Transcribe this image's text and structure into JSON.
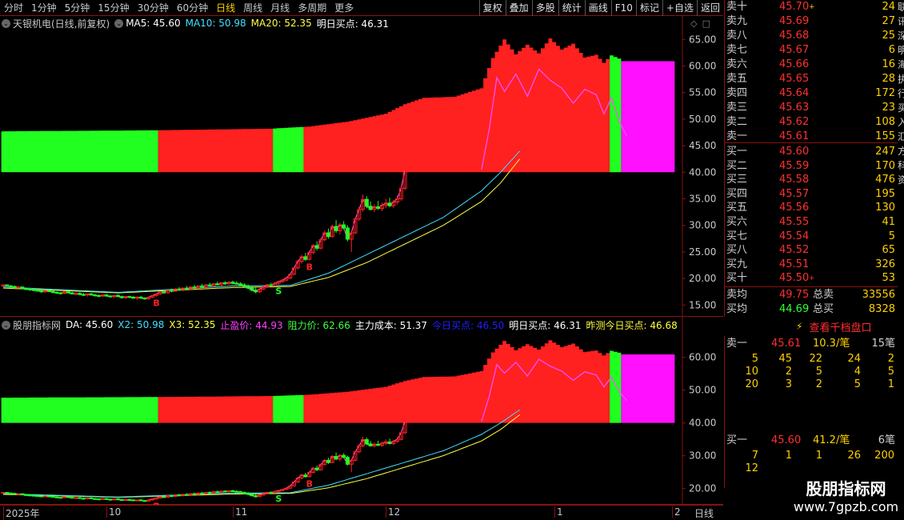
{
  "toolbar": {
    "periods": [
      "分时",
      "1分钟",
      "5分钟",
      "15分钟",
      "30分钟",
      "60分钟",
      "日线",
      "周线",
      "月线",
      "多周期",
      "更多"
    ],
    "active_period": 6,
    "tools": [
      "复权",
      "叠加",
      "多股",
      "统计",
      "画线",
      "F10",
      "标记",
      "+自选",
      "返回"
    ]
  },
  "main_chart": {
    "stock_name": "天银机电(日线,前复权)",
    "ma5_label": "MA5: 45.60",
    "ma10_label": "MA10: 50.98",
    "ma20_label": "MA20: 52.35",
    "buy_point_label": "明日买点: 46.31",
    "price_axis": [
      "65.00",
      "60.00",
      "55.00",
      "50.00",
      "45.00",
      "40.00",
      "35.00",
      "30.00",
      "25.00",
      "20.00",
      "15.00"
    ],
    "marker_labels": [
      "B",
      "S",
      "B"
    ]
  },
  "sub_chart": {
    "indicator_name": "股朋指标网",
    "da_label": "DA: 45.60",
    "x2_label": "X2: 50.98",
    "x3_label": "X3: 52.35",
    "stop_profit_label": "止盈价: 44.93",
    "resistance_label": "阻力价: 62.66",
    "main_cost_label": "主力成本: 51.37",
    "today_buy_label": "今日买点: 46.50",
    "tomorrow_buy_label": "明日买点: 46.31",
    "yesterday_pred_label": "昨测今日买点: 46.68",
    "price_axis": [
      "60.00",
      "50.00",
      "40.00",
      "30.00",
      "20.00"
    ]
  },
  "time_axis": {
    "labels": [
      "2025年",
      "10",
      "11",
      "12",
      "1",
      "2"
    ],
    "mode": "日线"
  },
  "colors": {
    "up": "#ff2020",
    "down": "#20ff20",
    "magenta": "#ff10ff",
    "ma5": "#ffffff",
    "ma10": "#40e0ff",
    "ma20": "#ffff40",
    "frame": "#8a1010"
  },
  "orderbook": {
    "sell": [
      {
        "label": "卖十",
        "price": "45.70",
        "vol": "24",
        "mark": "+"
      },
      {
        "label": "卖九",
        "price": "45.69",
        "vol": "27",
        "mark": ""
      },
      {
        "label": "卖八",
        "price": "45.68",
        "vol": "25",
        "mark": ""
      },
      {
        "label": "卖七",
        "price": "45.67",
        "vol": "6",
        "mark": ""
      },
      {
        "label": "卖六",
        "price": "45.66",
        "vol": "16",
        "mark": ""
      },
      {
        "label": "卖五",
        "price": "45.65",
        "vol": "28",
        "mark": ""
      },
      {
        "label": "卖四",
        "price": "45.64",
        "vol": "172",
        "mark": ""
      },
      {
        "label": "卖三",
        "price": "45.63",
        "vol": "23",
        "mark": ""
      },
      {
        "label": "卖二",
        "price": "45.62",
        "vol": "108",
        "mark": ""
      },
      {
        "label": "卖一",
        "price": "45.61",
        "vol": "155",
        "mark": ""
      }
    ],
    "buy": [
      {
        "label": "买一",
        "price": "45.60",
        "vol": "247",
        "mark": ""
      },
      {
        "label": "买二",
        "price": "45.59",
        "vol": "170",
        "mark": ""
      },
      {
        "label": "买三",
        "price": "45.58",
        "vol": "476",
        "mark": ""
      },
      {
        "label": "买四",
        "price": "45.57",
        "vol": "195",
        "mark": ""
      },
      {
        "label": "买五",
        "price": "45.56",
        "vol": "130",
        "mark": ""
      },
      {
        "label": "买六",
        "price": "45.55",
        "vol": "41",
        "mark": ""
      },
      {
        "label": "买七",
        "price": "45.54",
        "vol": "5",
        "mark": ""
      },
      {
        "label": "买八",
        "price": "45.52",
        "vol": "65",
        "mark": ""
      },
      {
        "label": "买九",
        "price": "45.51",
        "vol": "326",
        "mark": ""
      },
      {
        "label": "买十",
        "price": "45.50",
        "vol": "53",
        "mark": "+"
      }
    ],
    "summary": {
      "sell_avg_label": "卖均",
      "sell_avg": "49.75",
      "total_sell_label": "总卖",
      "total_sell": "33556",
      "buy_avg_label": "买均",
      "buy_avg": "44.69",
      "total_buy_label": "总买",
      "total_buy": "8328"
    },
    "side_strip_text": "联讯深明海执行买入汇方科资"
  },
  "kilo": {
    "button_label": "查看千档盘口",
    "sell_head": {
      "label": "卖一",
      "price": "45.61",
      "avg": "10.3/笔",
      "count": "15笔"
    },
    "sell_rows": [
      [
        "5",
        "45",
        "22",
        "24",
        "2"
      ],
      [
        "10",
        "2",
        "5",
        "4",
        "5"
      ],
      [
        "20",
        "3",
        "2",
        "5",
        "1"
      ]
    ],
    "buy_head": {
      "label": "买一",
      "price": "45.60",
      "avg": "41.2/笔",
      "count": "6笔"
    },
    "buy_rows": [
      [
        "7",
        "1",
        "1",
        "26",
        "200"
      ],
      [
        "12",
        "",
        "",
        "",
        ""
      ]
    ]
  },
  "watermark": {
    "title": "股朋指标网",
    "url": "www.7gpzb.com"
  },
  "chart_data": {
    "type": "candlestick",
    "y_range": [
      14,
      67
    ],
    "candles": [
      [
        18.6,
        18.9,
        18.4,
        18.8
      ],
      [
        18.8,
        18.9,
        18.5,
        18.6
      ],
      [
        18.6,
        18.8,
        18.3,
        18.5
      ],
      [
        18.5,
        18.7,
        18.2,
        18.3
      ],
      [
        18.3,
        18.6,
        18.1,
        18.4
      ],
      [
        18.4,
        18.5,
        18.0,
        18.1
      ],
      [
        18.1,
        18.3,
        17.8,
        18.0
      ],
      [
        18.0,
        18.2,
        17.7,
        17.9
      ],
      [
        17.9,
        18.1,
        17.6,
        17.8
      ],
      [
        17.8,
        18.0,
        17.5,
        17.7
      ],
      [
        17.7,
        17.9,
        17.3,
        17.5
      ],
      [
        17.5,
        17.8,
        17.3,
        17.7
      ],
      [
        17.7,
        17.9,
        17.4,
        17.6
      ],
      [
        17.6,
        17.8,
        17.2,
        17.4
      ],
      [
        17.4,
        17.6,
        17.1,
        17.3
      ],
      [
        17.3,
        17.5,
        17.0,
        17.2
      ],
      [
        17.2,
        17.6,
        17.1,
        17.5
      ],
      [
        17.5,
        17.7,
        17.2,
        17.3
      ],
      [
        17.3,
        17.5,
        17.0,
        17.1
      ],
      [
        17.1,
        17.4,
        16.8,
        17.2
      ],
      [
        17.2,
        17.4,
        16.9,
        17.0
      ],
      [
        17.0,
        17.3,
        16.7,
        16.9
      ],
      [
        16.9,
        17.2,
        16.6,
        17.1
      ],
      [
        17.1,
        17.3,
        16.8,
        16.9
      ],
      [
        16.9,
        17.1,
        16.6,
        16.8
      ],
      [
        16.8,
        17.0,
        16.5,
        16.7
      ],
      [
        16.7,
        17.0,
        16.5,
        16.9
      ],
      [
        16.9,
        17.1,
        16.6,
        16.7
      ],
      [
        16.7,
        16.9,
        16.4,
        16.6
      ],
      [
        16.6,
        16.9,
        16.3,
        16.8
      ],
      [
        16.8,
        17.0,
        16.5,
        16.6
      ],
      [
        16.6,
        16.8,
        16.2,
        16.4
      ],
      [
        16.4,
        16.7,
        16.1,
        16.6
      ],
      [
        16.6,
        16.8,
        16.3,
        16.5
      ],
      [
        16.5,
        16.7,
        16.2,
        16.3
      ],
      [
        16.3,
        16.6,
        16.0,
        16.5
      ],
      [
        16.5,
        16.7,
        16.2,
        16.3
      ],
      [
        16.3,
        16.5,
        16.0,
        16.2
      ],
      [
        16.2,
        16.6,
        16.0,
        16.5
      ],
      [
        16.5,
        16.9,
        16.3,
        16.8
      ],
      [
        16.8,
        17.2,
        16.6,
        17.1
      ],
      [
        17.1,
        17.6,
        16.9,
        17.5
      ],
      [
        17.5,
        17.8,
        17.1,
        17.3
      ],
      [
        17.3,
        17.9,
        17.2,
        17.8
      ],
      [
        17.8,
        18.1,
        17.4,
        17.6
      ],
      [
        17.6,
        18.2,
        17.5,
        18.0
      ],
      [
        18.0,
        18.4,
        17.7,
        17.8
      ],
      [
        17.8,
        18.3,
        17.6,
        18.2
      ],
      [
        18.2,
        18.6,
        17.9,
        18.0
      ],
      [
        18.0,
        18.5,
        17.8,
        18.4
      ],
      [
        18.4,
        18.8,
        18.1,
        18.2
      ],
      [
        18.2,
        18.7,
        18.0,
        18.6
      ],
      [
        18.6,
        19.0,
        18.2,
        18.4
      ],
      [
        18.4,
        18.9,
        18.2,
        18.8
      ],
      [
        18.8,
        19.2,
        18.5,
        18.6
      ],
      [
        18.6,
        19.1,
        18.4,
        19.0
      ],
      [
        19.0,
        19.4,
        18.7,
        18.8
      ],
      [
        18.8,
        19.3,
        18.6,
        19.2
      ],
      [
        19.2,
        19.5,
        18.8,
        19.0
      ],
      [
        19.0,
        19.5,
        18.8,
        19.3
      ],
      [
        19.3,
        19.6,
        18.9,
        19.1
      ],
      [
        19.1,
        19.5,
        18.8,
        19.0
      ],
      [
        19.0,
        19.3,
        18.6,
        18.8
      ],
      [
        18.8,
        19.1,
        18.3,
        18.5
      ],
      [
        18.5,
        18.9,
        18.0,
        18.2
      ],
      [
        18.2,
        18.6,
        17.6,
        17.8
      ],
      [
        17.8,
        18.3,
        17.2,
        17.5
      ],
      [
        17.5,
        18.2,
        17.3,
        18.0
      ],
      [
        18.0,
        18.6,
        17.8,
        18.4
      ],
      [
        18.4,
        19.0,
        18.2,
        18.8
      ],
      [
        18.8,
        19.2,
        18.5,
        18.7
      ],
      [
        18.7,
        19.3,
        18.5,
        19.1
      ],
      [
        19.1,
        19.6,
        18.9,
        19.4
      ],
      [
        19.4,
        19.9,
        19.2,
        19.7
      ],
      [
        19.7,
        20.3,
        19.5,
        20.1
      ],
      [
        20.1,
        21.0,
        19.9,
        20.8
      ],
      [
        20.8,
        22.2,
        20.6,
        22.0
      ],
      [
        22.0,
        23.5,
        21.7,
        23.2
      ],
      [
        23.2,
        24.5,
        22.8,
        24.1
      ],
      [
        24.1,
        24.8,
        23.3,
        23.6
      ],
      [
        23.6,
        25.2,
        23.4,
        24.9
      ],
      [
        24.9,
        26.5,
        24.6,
        26.2
      ],
      [
        26.2,
        27.0,
        25.3,
        25.7
      ],
      [
        25.7,
        27.6,
        25.5,
        27.3
      ],
      [
        27.3,
        29.0,
        27.0,
        28.6
      ],
      [
        28.6,
        29.4,
        27.5,
        27.9
      ],
      [
        27.9,
        30.2,
        27.7,
        29.8
      ],
      [
        29.8,
        31.0,
        28.6,
        29.0
      ],
      [
        29.0,
        30.5,
        28.3,
        30.1
      ],
      [
        30.1,
        30.8,
        29.2,
        29.5
      ],
      [
        29.5,
        30.0,
        27.0,
        27.4
      ],
      [
        27.4,
        29.0,
        25.0,
        28.6
      ],
      [
        28.6,
        31.5,
        28.3,
        31.2
      ],
      [
        31.2,
        33.5,
        30.8,
        33.0
      ],
      [
        33.0,
        35.8,
        32.6,
        34.9
      ],
      [
        34.9,
        35.5,
        33.2,
        33.6
      ],
      [
        33.6,
        34.5,
        32.8,
        33.0
      ],
      [
        33.0,
        34.0,
        32.5,
        33.5
      ],
      [
        33.5,
        34.6,
        32.9,
        33.2
      ],
      [
        33.2,
        34.3,
        32.7,
        33.8
      ],
      [
        33.8,
        35.0,
        33.2,
        34.2
      ],
      [
        34.2,
        35.2,
        33.4,
        33.7
      ],
      [
        33.7,
        34.8,
        33.3,
        34.4
      ],
      [
        34.4,
        35.6,
        33.9,
        35.0
      ],
      [
        35.0,
        37.5,
        34.6,
        37.0
      ],
      [
        37.0,
        41.0,
        36.6,
        40.5
      ]
    ],
    "strip_segments": [
      {
        "from": 0,
        "to": 40,
        "color": "down"
      },
      {
        "from": 41,
        "to": 70,
        "color": "up"
      },
      {
        "from": 71,
        "to": 78,
        "color": "down"
      },
      {
        "from": 79,
        "to": 158,
        "color": "up"
      },
      {
        "from": 159,
        "to": 161,
        "color": "down"
      },
      {
        "from": 162,
        "to": 175,
        "color": "magenta"
      }
    ],
    "strip_base": 40,
    "strip_tops": [
      [
        0,
        47.7
      ],
      [
        40,
        47.9
      ],
      [
        70,
        48.2
      ],
      [
        80,
        48.6
      ],
      [
        90,
        49.5
      ],
      [
        100,
        51.0
      ],
      [
        105,
        52.8
      ],
      [
        110,
        54.0
      ],
      [
        118,
        54.2
      ],
      [
        125,
        55.8
      ],
      [
        128,
        61.5
      ],
      [
        131,
        65.0
      ],
      [
        134,
        62.2
      ],
      [
        137,
        64.0
      ],
      [
        140,
        62.4
      ],
      [
        143,
        65.2
      ],
      [
        146,
        63.1
      ],
      [
        149,
        64.2
      ],
      [
        152,
        61.6
      ],
      [
        155,
        62.1
      ],
      [
        157,
        60.6
      ],
      [
        159,
        62.0
      ],
      [
        161,
        61.4
      ],
      [
        162,
        60.9
      ],
      [
        175,
        60.9
      ]
    ],
    "pink_line": [
      [
        125,
        40.5
      ],
      [
        127,
        48.0
      ],
      [
        129,
        57.8
      ],
      [
        131,
        55.2
      ],
      [
        134,
        58.5
      ],
      [
        137,
        54.3
      ],
      [
        140,
        59.4
      ],
      [
        143,
        57.3
      ],
      [
        146,
        55.8
      ],
      [
        149,
        53.0
      ],
      [
        152,
        55.6
      ],
      [
        155,
        54.6
      ],
      [
        157,
        51.0
      ],
      [
        159,
        54.0
      ],
      [
        161,
        49.5
      ],
      [
        163,
        46.8
      ]
    ],
    "ma10": [
      [
        0,
        18.4
      ],
      [
        30,
        17.4
      ],
      [
        60,
        18.6
      ],
      [
        75,
        18.7
      ],
      [
        85,
        21.0
      ],
      [
        95,
        24.5
      ],
      [
        105,
        28.0
      ],
      [
        115,
        31.5
      ],
      [
        125,
        36.5
      ],
      [
        130,
        40.0
      ],
      [
        135,
        44.0
      ]
    ],
    "ma20": [
      [
        0,
        18.2
      ],
      [
        30,
        17.3
      ],
      [
        60,
        18.3
      ],
      [
        75,
        18.5
      ],
      [
        85,
        20.2
      ],
      [
        95,
        23.0
      ],
      [
        105,
        26.5
      ],
      [
        115,
        30.0
      ],
      [
        125,
        34.5
      ],
      [
        130,
        38.0
      ],
      [
        135,
        42.5
      ]
    ],
    "markers": [
      {
        "index": 40,
        "kind": "B"
      },
      {
        "index": 72,
        "kind": "S"
      },
      {
        "index": 80,
        "kind": "B"
      }
    ]
  }
}
